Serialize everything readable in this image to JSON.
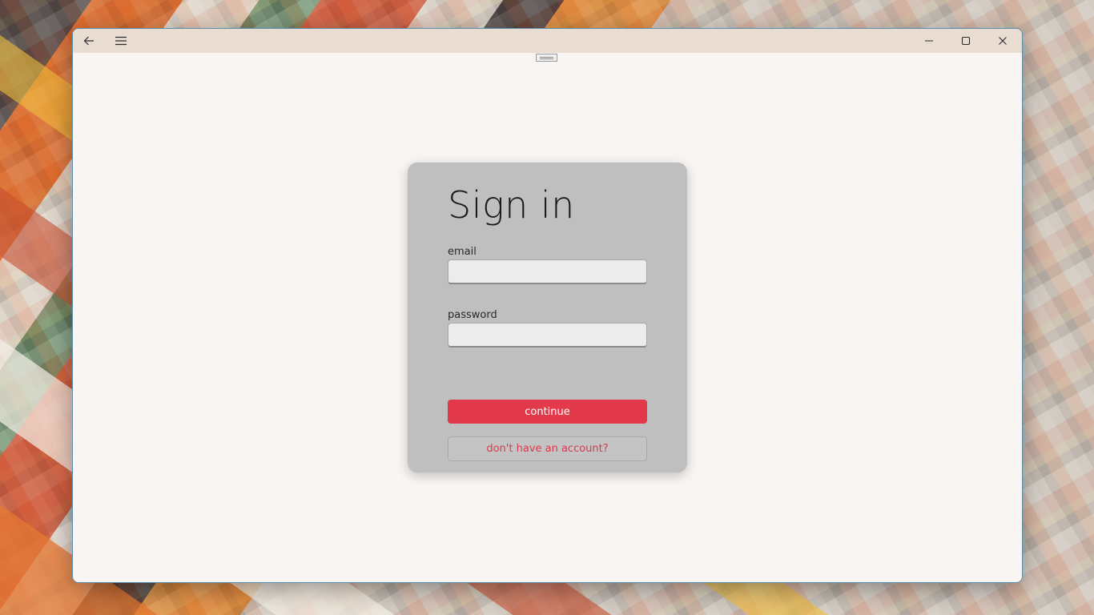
{
  "window": {
    "icons": {
      "back": "back-arrow-icon",
      "menu": "hamburger-menu-icon",
      "minimize": "minimize-icon",
      "maximize": "maximize-icon",
      "close": "close-icon"
    }
  },
  "signin": {
    "title": "Sign in",
    "email_label": "email",
    "email_value": "",
    "password_label": "password",
    "password_value": "",
    "continue_label": "continue",
    "signup_label": "don't have an account?"
  },
  "colors": {
    "accent": "#e23a4b",
    "link_text": "#d8394a",
    "card_background": "#bfbfbf",
    "window_background": "#f8f5f2",
    "titlebar_background": "#e9ddd2"
  }
}
